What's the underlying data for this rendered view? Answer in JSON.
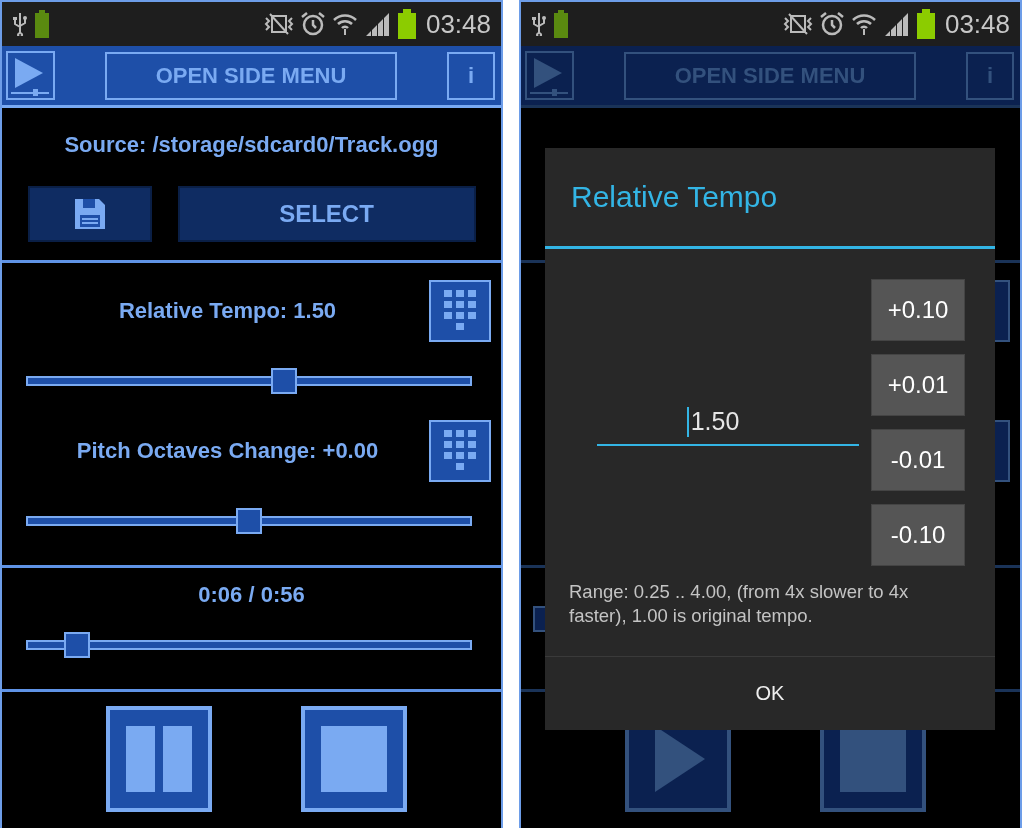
{
  "screens": [
    {
      "status_bar": {
        "time": "03:48"
      },
      "toolbar": {
        "menu_button": "OPEN SIDE MENU",
        "info_button": "i"
      },
      "source": "Source: /storage/sdcard0/Track.ogg",
      "select_button": "SELECT",
      "sliders": [
        {
          "label": "Relative Tempo: 1.50",
          "level": 0.58
        },
        {
          "label": "Pitch Octaves Change: +0.00",
          "level": 0.5
        }
      ],
      "position": {
        "label": "0:06 / 0:56",
        "level": 0.11
      },
      "transport": {
        "playing": true
      }
    },
    {
      "status_bar": {
        "time": "03:48"
      },
      "toolbar": {
        "menu_button": "OPEN SIDE MENU",
        "info_button": "i"
      },
      "transport": {
        "playing": false
      },
      "dialog": {
        "title": "Relative Tempo",
        "value": "1.50",
        "step_buttons": [
          "+0.10",
          "+0.01",
          "-0.01",
          "-0.10"
        ],
        "hint": "Range: 0.25 .. 4.00, (from 4x slower to 4x faster), 1.00 is original tempo.",
        "ok_button": "OK"
      }
    }
  ]
}
